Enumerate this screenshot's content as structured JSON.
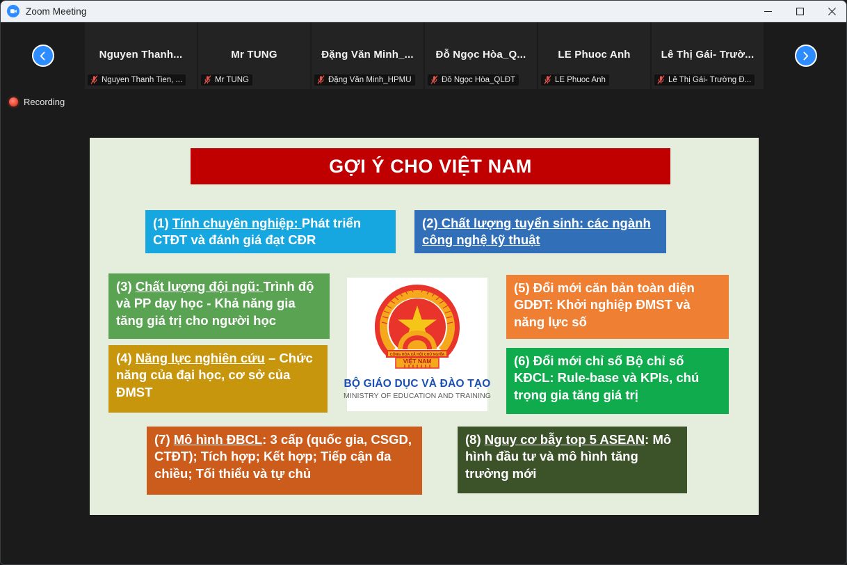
{
  "window": {
    "title": "Zoom Meeting",
    "logo_icon": "zoom-logo-icon",
    "controls": {
      "minimize": "minimize-icon",
      "maximize": "maximize-icon",
      "close": "close-icon"
    }
  },
  "filmstrip": {
    "prev_icon": "chevron-left-icon",
    "next_icon": "chevron-right-icon",
    "mic_icon": "microphone-muted-icon",
    "participants": [
      {
        "display_name": "Nguyen  Thanh...",
        "label": "Nguyen Thanh Tien, ...",
        "muted": true
      },
      {
        "display_name": "Mr TUNG",
        "label": "Mr TUNG",
        "muted": true
      },
      {
        "display_name": "Đặng  Văn  Minh_...",
        "label": "Đặng Văn Minh_HPMU",
        "muted": true
      },
      {
        "display_name": "Đỗ  Ngọc  Hòa_Q...",
        "label": "Đỗ Ngọc Hòa_QLĐT",
        "muted": true
      },
      {
        "display_name": "LE Phuoc Anh",
        "label": "LE Phuoc Anh",
        "muted": true
      },
      {
        "display_name": "Lê Thị Gái- Trườ...",
        "label": "Lê Thị Gái- Trường Đ...",
        "muted": true
      }
    ]
  },
  "status": {
    "recording_label": "Recording",
    "recording_icon": "recording-dot-icon"
  },
  "slide": {
    "background_color": "#e5eedd",
    "title": "GỢI Ý CHO VIỆT NAM",
    "title_color": "#c00000",
    "boxes": [
      {
        "id": "1",
        "prefix": "(1) ",
        "heading": "Tính chuyên nghiệp: ",
        "body": "Phát triển CTĐT và đánh giá đạt CĐR",
        "color": "#17a7e0"
      },
      {
        "id": "2",
        "prefix": "(2)",
        "heading": " Chất lượng tuyển sinh: các ngành công nghệ kỹ thuật",
        "body": "",
        "color": "#3170b8"
      },
      {
        "id": "3",
        "prefix": "(3) ",
        "heading": "Chất lượng đội ngũ: ",
        "body": "Trình độ và PP dạy học - Khả năng gia tăng giá trị cho người học",
        "color": "#5aa353"
      },
      {
        "id": "4",
        "prefix": "(4) ",
        "heading": "Năng lực nghiên cứu",
        "body": " – Chức năng của đại học, cơ sở của ĐMST",
        "color": "#c8960c"
      },
      {
        "id": "5",
        "prefix": "(5) ",
        "heading": "",
        "body": "Đổi mới căn bản toàn diện GDĐT: Khởi nghiệp ĐMST và năng lực số",
        "color": "#ee7f33"
      },
      {
        "id": "6",
        "prefix": "(6) ",
        "heading": "",
        "body": "Đổi mới chỉ số Bộ chỉ số KĐCL: Rule-base và KPIs, chú trọng gia tăng giá trị",
        "color": "#10ab4d"
      },
      {
        "id": "7",
        "prefix": "(7) ",
        "heading": "Mô hình ĐBCL",
        "body": ": 3 cấp (quốc gia, CSGD, CTĐT); Tích hợp; Kết hợp; Tiếp cận đa chiều; Tối thiểu và tự chủ",
        "color": "#cc5c1b"
      },
      {
        "id": "8",
        "prefix": "(8) ",
        "heading": "Nguy cơ bẫy top 5 ASEAN",
        "body": ": Mô hình đầu tư và mô hình tăng trưởng mới",
        "color": "#3c5228"
      }
    ],
    "emblem": {
      "icon": "vietnam-national-emblem-icon",
      "line1": "BỘ GIÁO DỤC VÀ ĐÀO TẠO",
      "line2": "MINISTRY OF EDUCATION AND TRAINING"
    }
  }
}
